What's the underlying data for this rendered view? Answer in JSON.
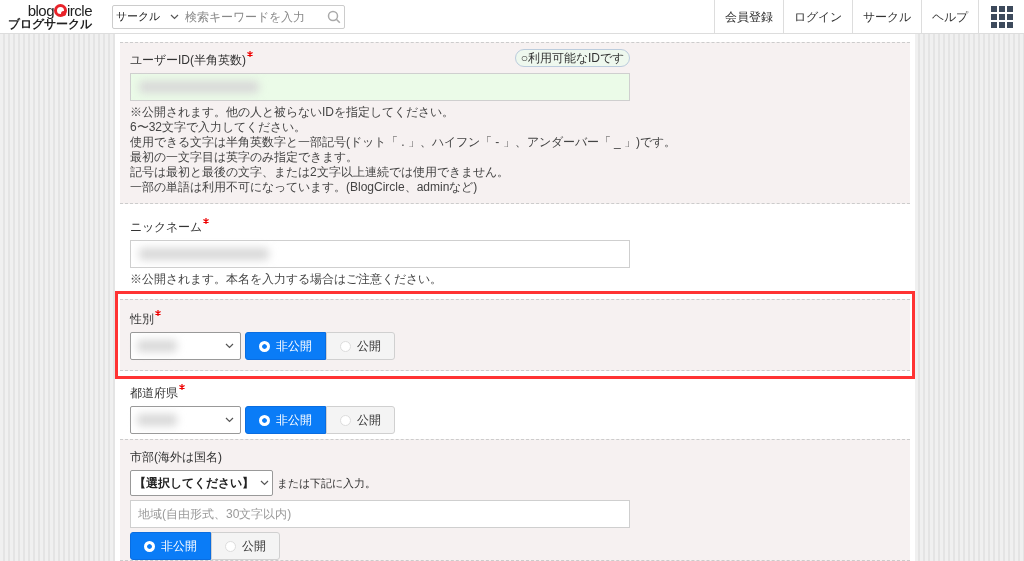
{
  "header": {
    "logo": {
      "left": "blog",
      "right": "ircle",
      "sub": "ブログサークル"
    },
    "search": {
      "category": "サークル",
      "placeholder": "検索キーワードを入力"
    },
    "nav": [
      "会員登録",
      "ログイン",
      "サークル",
      "ヘルプ"
    ]
  },
  "sections": [
    {
      "kind": "userid",
      "shaded": true,
      "highlighted": false,
      "label": "ユーザーID(半角英数)",
      "required": true,
      "status": "○利用可能なIDです",
      "notes": [
        "※公開されます。他の人と被らないIDを指定してください。",
        "6〜32文字で入力してください。",
        "使用できる文字は半角英数字と一部記号(ドット「 . 」、ハイフン「 - 」、アンダーバー「 _ 」)です。",
        "最初の一文字目は英字のみ指定できます。",
        "記号は最初と最後の文字、または2文字以上連続では使用できません。",
        "一部の単語は利用不可になっています。(BlogCircle、adminなど)"
      ]
    },
    {
      "kind": "nickname",
      "shaded": false,
      "highlighted": false,
      "label": "ニックネーム",
      "required": true,
      "notes": [
        "※公開されます。本名を入力する場合はご注意ください。"
      ]
    },
    {
      "kind": "select",
      "shaded": true,
      "highlighted": true,
      "label": "性別",
      "required": true,
      "visibility": [
        {
          "label": "非公開",
          "selected": true
        },
        {
          "label": "公開",
          "selected": false
        }
      ]
    },
    {
      "kind": "select",
      "shaded": false,
      "highlighted": false,
      "label": "都道府県",
      "required": true,
      "visibility": [
        {
          "label": "非公開",
          "selected": true
        },
        {
          "label": "公開",
          "selected": false
        }
      ]
    },
    {
      "kind": "city",
      "shaded": true,
      "highlighted": false,
      "label": "市部(海外は国名)",
      "required": false,
      "select": "【選択してください】",
      "or_text": "または下記に入力。",
      "placeholder": "地域(自由形式、30文字以内)",
      "visibility": [
        {
          "label": "非公開",
          "selected": true
        },
        {
          "label": "公開",
          "selected": false
        }
      ]
    }
  ]
}
